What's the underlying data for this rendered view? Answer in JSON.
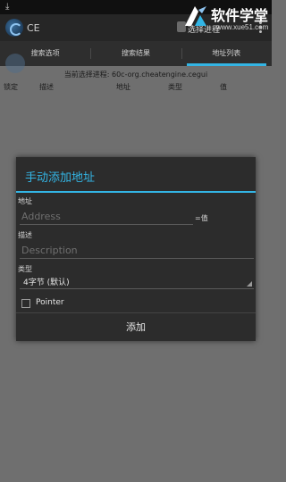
{
  "status_bar": {
    "download_icon": "download-icon"
  },
  "watermark": {
    "title": "软件学堂",
    "url": "www.xue51.com"
  },
  "action_bar": {
    "app_title": "CE",
    "select_process": "选择进程"
  },
  "tabs": [
    {
      "label": "搜索选项",
      "active": false
    },
    {
      "label": "搜索结果",
      "active": false
    },
    {
      "label": "地址列表",
      "active": true
    }
  ],
  "main": {
    "current_process": "当前选择进程: 60c-org.cheatengine.cegui",
    "columns": [
      "锁定",
      "描述",
      "地址",
      "类型",
      "值"
    ]
  },
  "dialog": {
    "title": "手动添加地址",
    "address_label": "地址",
    "address_placeholder": "Address",
    "equals_value": "=值",
    "description_label": "描述",
    "description_placeholder": "Description",
    "type_label": "类型",
    "type_value": "4字节 (默认)",
    "pointer_label": "Pointer",
    "pointer_checked": false,
    "add_button": "添加"
  },
  "colors": {
    "accent": "#33b5e5",
    "dialog_bg": "#2c2c2c",
    "page_bg": "#6f6f6f"
  }
}
